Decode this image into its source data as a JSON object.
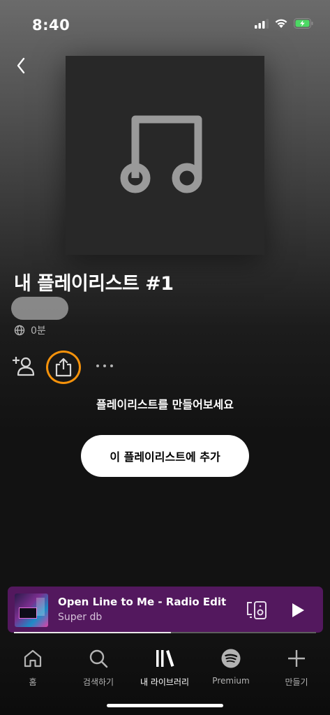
{
  "status_bar": {
    "time": "8:40"
  },
  "playlist": {
    "title": "내 플레이리스트 #1",
    "duration": "0분"
  },
  "empty_state": {
    "prompt": "플레이리스트를 만들어보세요",
    "add_button_label": "이 플레이리스트에 추가"
  },
  "now_playing": {
    "title": "Open Line to Me - Radio Edit",
    "artist": "Super db",
    "progress": 0.52
  },
  "tabs": [
    {
      "label": "홈",
      "icon": "home-icon"
    },
    {
      "label": "검색하기",
      "icon": "search-icon"
    },
    {
      "label": "내 라이브러리",
      "icon": "library-icon",
      "active": true
    },
    {
      "label": "Premium",
      "icon": "spotify-icon"
    },
    {
      "label": "만들기",
      "icon": "plus-icon"
    }
  ],
  "colors": {
    "share_highlight": "#f5920b",
    "mini_player_bg": "#53185e"
  }
}
